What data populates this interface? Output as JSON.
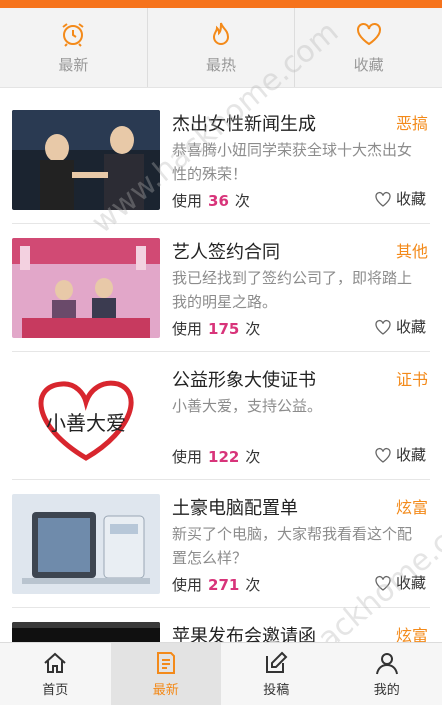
{
  "colors": {
    "accent": "#f6731c",
    "tag": "#f38a1a",
    "count": "#d8347a"
  },
  "tabs": [
    {
      "label": "最新",
      "icon": "alarm-clock-icon"
    },
    {
      "label": "最热",
      "icon": "flame-icon"
    },
    {
      "label": "收藏",
      "icon": "heart-icon"
    }
  ],
  "items": [
    {
      "title": "杰出女性新闻生成",
      "tag": "恶搞",
      "desc": "恭喜腾小妞同学荣获全球十大杰出女性的殊荣！",
      "usage_prefix": "使用",
      "count": "36",
      "usage_suffix": "次",
      "fav_label": "收藏"
    },
    {
      "title": "艺人签约合同",
      "tag": "其他",
      "desc": "我已经找到了签约公司了，即将踏上我的明星之路。",
      "usage_prefix": "使用",
      "count": "175",
      "usage_suffix": "次",
      "fav_label": "收藏"
    },
    {
      "title": "公益形象大使证书",
      "tag": "证书",
      "desc": "小善大爱，支持公益。",
      "usage_prefix": "使用",
      "count": "122",
      "usage_suffix": "次",
      "fav_label": "收藏",
      "thumb_text": "小善大爱"
    },
    {
      "title": "土豪电脑配置单",
      "tag": "炫富",
      "desc": "新买了个电脑，大家帮我看看这个配置怎么样？",
      "usage_prefix": "使用",
      "count": "271",
      "usage_suffix": "次",
      "fav_label": "收藏"
    },
    {
      "title": "苹果发布会邀请函",
      "tag": "炫富",
      "desc": "",
      "usage_prefix": "",
      "count": "",
      "usage_suffix": "",
      "fav_label": ""
    }
  ],
  "bottom_nav": [
    {
      "label": "首页",
      "icon": "home-icon"
    },
    {
      "label": "最新",
      "icon": "document-icon",
      "active": true
    },
    {
      "label": "投稿",
      "icon": "edit-icon"
    },
    {
      "label": "我的",
      "icon": "user-icon"
    }
  ],
  "watermark": "www.hackhome.com"
}
